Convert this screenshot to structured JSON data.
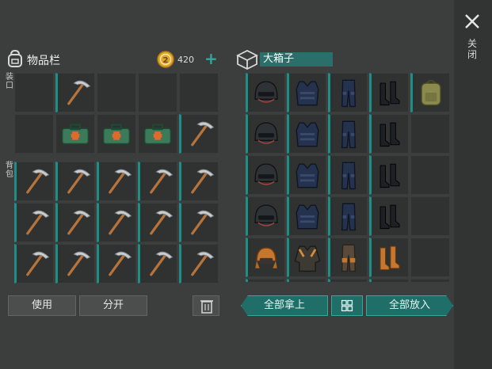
{
  "close": {
    "label": "关闭",
    "icon": "close-x-icon"
  },
  "inventory": {
    "title": "物品栏",
    "coins": "420",
    "plus": "+",
    "side_label_top": "装口",
    "side_label_bottom": "背包",
    "use_button": "使用",
    "split_button": "分开",
    "quick_slots": [
      {
        "item": "empty"
      },
      {
        "item": "pickaxe"
      },
      {
        "item": "empty"
      },
      {
        "item": "empty"
      },
      {
        "item": "empty"
      },
      {
        "item": "empty"
      },
      {
        "item": "medkit"
      },
      {
        "item": "medkit"
      },
      {
        "item": "medkit"
      },
      {
        "item": "pickaxe"
      }
    ],
    "backpack_slots": [
      "pickaxe",
      "pickaxe",
      "pickaxe",
      "pickaxe",
      "pickaxe",
      "pickaxe",
      "pickaxe",
      "pickaxe",
      "pickaxe",
      "pickaxe",
      "pickaxe",
      "pickaxe",
      "pickaxe",
      "pickaxe",
      "pickaxe"
    ]
  },
  "chest": {
    "title": "大箱子",
    "take_all_button": "全部拿上",
    "put_all_button": "全部放入",
    "slots": [
      "helmet",
      "vest",
      "pants",
      "boots",
      "backpack",
      "helmet",
      "vest",
      "pants",
      "boots",
      "empty",
      "helmet",
      "vest",
      "pants",
      "boots",
      "empty",
      "helmet",
      "vest",
      "pants",
      "boots",
      "empty",
      "fur-hat",
      "jacket",
      "leather-pants",
      "leather-boots",
      "empty"
    ]
  },
  "colors": {
    "accent": "#1e8f86",
    "coin": "#e3a82b",
    "background": "#3b3e3d"
  }
}
